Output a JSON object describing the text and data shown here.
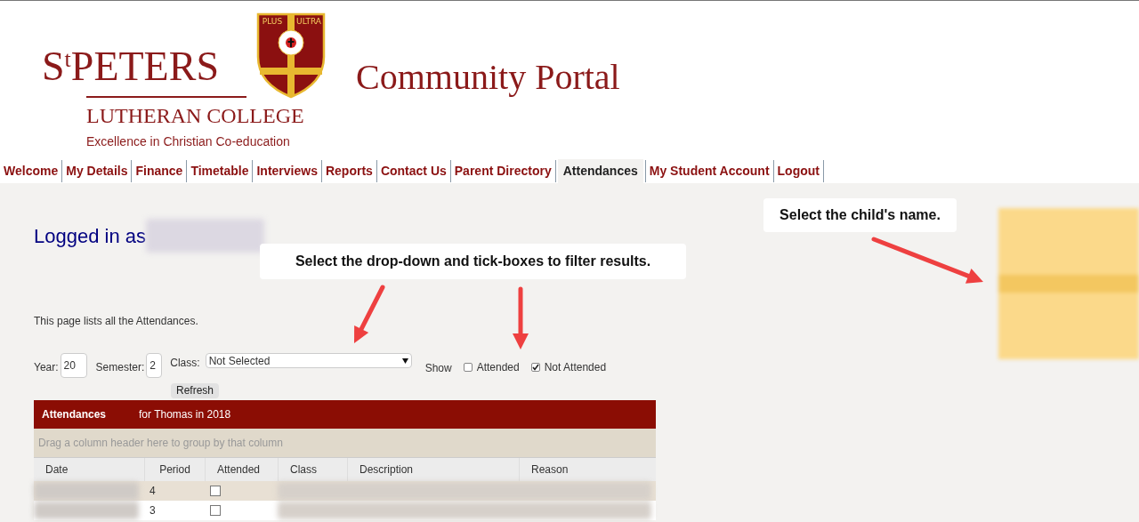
{
  "logo": {
    "initial": "S",
    "initial_sup": "t",
    "name": "PETERS",
    "subtitle": "LUTHERAN COLLEGE",
    "tagline": "Excellence in Christian Co-education",
    "motto": [
      "PLUS",
      "ULTRA"
    ]
  },
  "portal_title": "Community Portal",
  "nav": [
    {
      "label": "Welcome",
      "selected": false
    },
    {
      "label": "My Details",
      "selected": false
    },
    {
      "label": "Finance",
      "selected": false
    },
    {
      "label": "Timetable",
      "selected": false
    },
    {
      "label": "Interviews",
      "selected": false
    },
    {
      "label": "Reports",
      "selected": false
    },
    {
      "label": "Contact Us",
      "selected": false
    },
    {
      "label": "Parent Directory",
      "selected": false
    },
    {
      "label": "Attendances",
      "selected": true
    },
    {
      "label": "My Student Account",
      "selected": false
    },
    {
      "label": "Logout",
      "selected": false
    }
  ],
  "login": {
    "label": "Logged in as"
  },
  "intro": "This page lists all the Attendances.",
  "filters": {
    "year": {
      "label": "Year:",
      "value": "20"
    },
    "semester": {
      "label": "Semester:",
      "value": "2"
    },
    "class": {
      "label": "Class:",
      "value": "Not Selected"
    },
    "show_label": "Show",
    "checks": [
      {
        "label": "Attended",
        "checked": false
      },
      {
        "label": "Not Attended",
        "checked": true
      }
    ],
    "refresh": "Refresh"
  },
  "table": {
    "title": "Attendances",
    "subtitle": "for Thomas in 2018",
    "group_hint": "Drag a column header here to group by that column",
    "columns": [
      "Date",
      "Period",
      "Attended",
      "Class",
      "Description",
      "Reason"
    ],
    "rows": [
      {
        "period": "4",
        "attended": false
      },
      {
        "period": "3",
        "attended": false
      }
    ]
  },
  "annotations": [
    {
      "text": "Select the drop-down and tick-boxes to filter results."
    },
    {
      "text": "Select the child's name."
    }
  ]
}
